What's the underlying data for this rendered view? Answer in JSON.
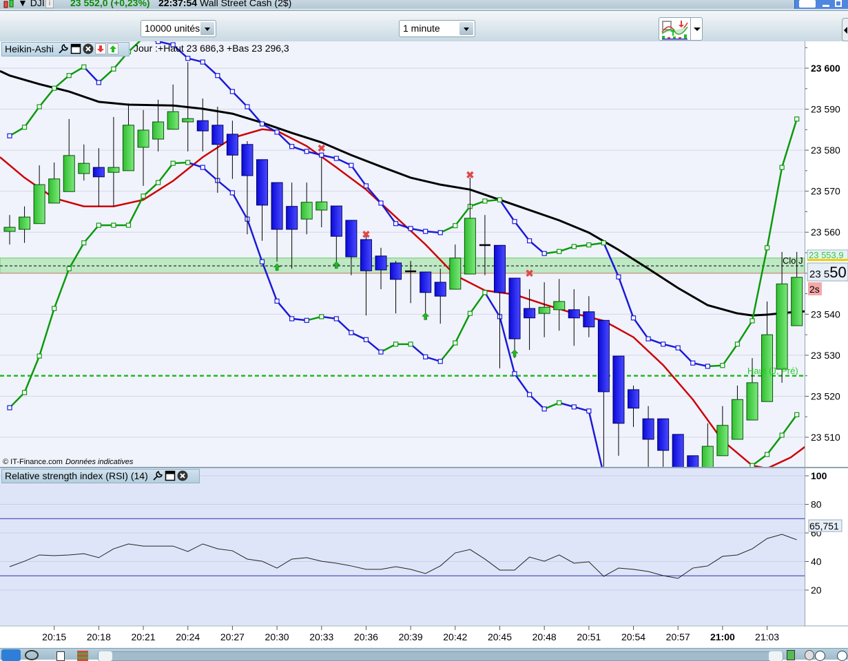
{
  "header": {
    "symbol": "DJI",
    "price_change": "23 552,0 (+0,23%)",
    "time": "22:37:54",
    "instrument": "Wall Street Cash (2$)"
  },
  "toolbar": {
    "quantity": "10000 unités",
    "timeframe": "1 minute"
  },
  "main_panel": {
    "indicator": "Heikin-Ashi",
    "day_info": "Jour :+Haut 23 686,3 +Bas 23 296,3",
    "copyright": "© IT-Finance.com",
    "disclaimer": "Données indicatives",
    "close_label": "Clo J",
    "prev_high_label": "Haut (J, Pré)",
    "close_price_tag": "23 553,9",
    "current_price_prefix": "23 5",
    "current_price_suffix": "50",
    "countdown": "2s"
  },
  "rsi_panel": {
    "title": "Relative strength index (RSI) (14)",
    "value_tag": "65,751"
  },
  "colors": {
    "up": "#46d046",
    "down": "#1c1cf0",
    "ma_long": "#000000",
    "ma_short": "#cc0000",
    "band_up": "#0a9a0a",
    "band_down": "#1a1ad8",
    "level": "#22bb22"
  },
  "chart_data": {
    "type": "candlestick",
    "start_time": "20:12",
    "interval": "1 minute",
    "x_ticks": [
      "20:15",
      "20:18",
      "20:21",
      "20:24",
      "20:27",
      "20:30",
      "20:33",
      "20:36",
      "20:39",
      "20:42",
      "20:45",
      "20:48",
      "20:51",
      "20:54",
      "20:57",
      "21:00",
      "21:03"
    ],
    "y_ticks": [
      23510,
      23520,
      23530,
      23540,
      23550,
      23560,
      23570,
      23580,
      23590,
      23600
    ],
    "y_tick_labels": [
      "23 510",
      "23 520",
      "23 530",
      "23 540",
      "23 550",
      "23 560",
      "23 570",
      "23 580",
      "23 590",
      "23 600"
    ],
    "ylim": [
      23497,
      23606.5
    ],
    "candles": [
      [
        23560.2,
        23564.2,
        23557.0,
        23561.2
      ],
      [
        23560.7,
        23566.3,
        23557.4,
        23563.7
      ],
      [
        23562.1,
        23576.3,
        23562.1,
        23571.6
      ],
      [
        23567.1,
        23577.0,
        23567.1,
        23573.0
      ],
      [
        23569.9,
        23587.6,
        23569.9,
        23578.7
      ],
      [
        23574.3,
        23581.4,
        23572.6,
        23576.8
      ],
      [
        23575.8,
        23580.5,
        23566.3,
        23573.5
      ],
      [
        23574.6,
        23588.1,
        23566.3,
        23575.8
      ],
      [
        23575.0,
        23591.4,
        23575.0,
        23586.1
      ],
      [
        23580.7,
        23589.8,
        23571.3,
        23584.9
      ],
      [
        23582.7,
        23592.3,
        23579.7,
        23586.9
      ],
      [
        23585.1,
        23596.0,
        23585.1,
        23589.4
      ],
      [
        23586.9,
        23601.5,
        23579.7,
        23587.7
      ],
      [
        23587.2,
        23592.6,
        23579.7,
        23584.7
      ],
      [
        23586.1,
        23590.6,
        23569.6,
        23581.4
      ],
      [
        23583.9,
        23587.2,
        23573.0,
        23578.8
      ],
      [
        23581.4,
        23582.2,
        23559.5,
        23573.8
      ],
      [
        23577.7,
        23577.7,
        23557.9,
        23566.6
      ],
      [
        23572.1,
        23572.1,
        23552.8,
        23560.7
      ],
      [
        23566.3,
        23572.1,
        23551.1,
        23560.7
      ],
      [
        23563.2,
        23572.1,
        23559.5,
        23567.3
      ],
      [
        23565.4,
        23578.3,
        23561.2,
        23567.4
      ],
      [
        23566.4,
        23566.4,
        23552.8,
        23559.0
      ],
      [
        23562.9,
        23562.9,
        23549.5,
        23554.0
      ],
      [
        23558.2,
        23559.5,
        23539.7,
        23550.6
      ],
      [
        23554.2,
        23556.2,
        23546.1,
        23550.8
      ],
      [
        23552.5,
        23553.0,
        23540.2,
        23548.5
      ],
      [
        23550.5,
        23553.0,
        23542.7,
        23550.3
      ],
      [
        23550.3,
        23550.3,
        23540.2,
        23545.3
      ],
      [
        23547.8,
        23551.1,
        23537.7,
        23544.4
      ],
      [
        23546.1,
        23557.0,
        23546.1,
        23553.7
      ],
      [
        23549.8,
        23573.3,
        23549.8,
        23563.4
      ],
      [
        23556.9,
        23564.2,
        23549.5,
        23556.8
      ],
      [
        23556.8,
        23556.8,
        23526.8,
        23545.3
      ],
      [
        23548.8,
        23548.8,
        23529.3,
        23534.0
      ],
      [
        23541.4,
        23546.1,
        23531.3,
        23539.1
      ],
      [
        23540.2,
        23547.8,
        23534.4,
        23541.7
      ],
      [
        23541.1,
        23548.6,
        23536.0,
        23543.1
      ],
      [
        23541.1,
        23546.1,
        23532.3,
        23539.1
      ],
      [
        23540.6,
        23544.4,
        23534.4,
        23536.9
      ],
      [
        23538.5,
        23538.5,
        23502.8,
        23521.1
      ],
      [
        23529.8,
        23529.8,
        23505.5,
        23513.4
      ],
      [
        23521.6,
        23522.6,
        23512.5,
        23517.1
      ],
      [
        23514.5,
        23517.6,
        23502.8,
        23509.5
      ],
      [
        23514.5,
        23514.5,
        23502.8,
        23506.8
      ],
      [
        23510.7,
        23510.7,
        23501.0,
        23502.5
      ],
      [
        23505.5,
        23505.5,
        23499.5,
        23501.0
      ],
      [
        23501.5,
        23513.4,
        23500.0,
        23507.8
      ],
      [
        23505.5,
        23517.6,
        23505.5,
        23512.9
      ],
      [
        23509.5,
        23522.6,
        23509.5,
        23519.2
      ],
      [
        23514.2,
        23529.3,
        23514.2,
        23523.3
      ],
      [
        23518.7,
        23543.1,
        23518.7,
        23535.0
      ],
      [
        23526.6,
        23555.2,
        23523.3,
        23547.4
      ],
      [
        23537.2,
        23555.2,
        23537.2,
        23549.0
      ]
    ],
    "candle_fields": [
      "open",
      "high",
      "low",
      "close"
    ],
    "ma_long": [
      [
        -0.65,
        23599.3
      ],
      [
        0,
        23598.2
      ],
      [
        2,
        23596.1
      ],
      [
        4,
        23594.3
      ],
      [
        6,
        23591.8
      ],
      [
        8,
        23591.1
      ],
      [
        11,
        23590.9
      ],
      [
        13,
        23590.1
      ],
      [
        15,
        23588.9
      ],
      [
        17,
        23586.7
      ],
      [
        19,
        23584.2
      ],
      [
        21,
        23581.9
      ],
      [
        23,
        23578.8
      ],
      [
        25,
        23576.0
      ],
      [
        27,
        23573.3
      ],
      [
        29,
        23571.6
      ],
      [
        31,
        23570.4
      ],
      [
        33,
        23567.9
      ],
      [
        35,
        23565.4
      ],
      [
        37,
        23562.9
      ],
      [
        39,
        23559.9
      ],
      [
        41,
        23555.7
      ],
      [
        43,
        23551.1
      ],
      [
        45,
        23546.4
      ],
      [
        47,
        23542.2
      ],
      [
        49,
        23540.2
      ],
      [
        50,
        23539.7
      ],
      [
        51,
        23539.9
      ],
      [
        53,
        23540.6
      ],
      [
        53.6,
        23540.7
      ]
    ],
    "ma_short": [
      [
        -0.65,
        23578.3
      ],
      [
        1,
        23573.3
      ],
      [
        3,
        23568.3
      ],
      [
        5,
        23566.3
      ],
      [
        7,
        23566.3
      ],
      [
        9,
        23567.9
      ],
      [
        11,
        23572.5
      ],
      [
        13,
        23578.3
      ],
      [
        15,
        23583.0
      ],
      [
        17,
        23585.1
      ],
      [
        18,
        23584.7
      ],
      [
        20,
        23581.0
      ],
      [
        22,
        23575.8
      ],
      [
        24,
        23570.4
      ],
      [
        26,
        23563.7
      ],
      [
        28,
        23557.0
      ],
      [
        30,
        23549.5
      ],
      [
        32,
        23545.8
      ],
      [
        34,
        23544.8
      ],
      [
        36,
        23542.4
      ],
      [
        38,
        23540.2
      ],
      [
        40,
        23538.4
      ],
      [
        42,
        23534.4
      ],
      [
        44,
        23527.6
      ],
      [
        46,
        23519.2
      ],
      [
        48,
        23509.2
      ],
      [
        50,
        23503.1
      ],
      [
        51,
        23502.4
      ],
      [
        52.6,
        23505.1
      ],
      [
        53.6,
        23507.8
      ]
    ],
    "band_upper": [
      23583.5,
      23585.6,
      23590.6,
      23595.1,
      23598.2,
      23600.3,
      23596.5,
      23599.8,
      23604.0,
      23607.4,
      23606.5,
      23605.7,
      23602.4,
      23601.5,
      23598.2,
      23594.3,
      23590.6,
      23586.4,
      23584.4,
      23580.9,
      23579.7,
      23578.8,
      23578.0,
      23576.3,
      23571.3,
      23567.1,
      23562.1,
      23560.9,
      23560.2,
      23559.9,
      23561.6,
      23566.3,
      23567.6,
      23567.9,
      23562.6,
      23557.9,
      23554.8,
      23555.3,
      23556.5,
      23556.9,
      23557.4,
      23549.1,
      23539.1,
      23534.0,
      23532.7,
      23531.8,
      23528.1,
      23527.3,
      23527.5,
      23532.7,
      23538.4,
      23556.2,
      23575.8,
      23587.6
    ],
    "band_lower": [
      23517.2,
      23520.9,
      23529.8,
      23541.4,
      23551.1,
      23557.4,
      23561.7,
      23561.7,
      23561.7,
      23568.8,
      23572.1,
      23576.8,
      23577.0,
      23575.8,
      23572.6,
      23569.6,
      23563.2,
      23552.8,
      23543.2,
      23538.9,
      23538.5,
      23539.4,
      23538.9,
      23535.5,
      23533.8,
      23530.8,
      23532.7,
      23532.7,
      23529.6,
      23528.5,
      23533.0,
      23540.2,
      23545.3,
      23539.4,
      23525.5,
      23520.4,
      23516.9,
      23518.4,
      23517.4,
      23516.4,
      23500.8,
      23495.7,
      23492.4,
      23489.9,
      23488.2,
      23487.7,
      23489.0,
      23491.5,
      23494.9,
      23499.1,
      23503.1,
      23505.8,
      23510.5,
      23515.5
    ],
    "buy_signals": [
      [
        18,
        23551.5
      ],
      [
        22,
        23552.0
      ],
      [
        28,
        23539.5
      ],
      [
        34,
        23530.5
      ]
    ],
    "sell_signals": [
      [
        31,
        23574.0
      ],
      [
        24,
        23559.5
      ],
      [
        35,
        23550.0
      ],
      [
        21,
        23580.5
      ]
    ],
    "levels": {
      "prev_high": 23525.0,
      "close_band": [
        23550.0,
        23553.7
      ],
      "close_line": 23551.8
    },
    "rsi": {
      "ylim": [
        0,
        100
      ],
      "y_ticks": [
        20,
        40,
        60,
        80,
        100
      ],
      "levels": [
        30,
        70
      ],
      "values": [
        36.4,
        40.2,
        44.6,
        44.1,
        44.6,
        45.5,
        42.7,
        48.9,
        52.3,
        50.8,
        50.8,
        50.8,
        47.0,
        52.3,
        48.9,
        47.5,
        41.7,
        40.2,
        35.4,
        41.7,
        42.7,
        40.2,
        38.8,
        36.9,
        34.5,
        34.5,
        36.4,
        34.5,
        31.6,
        36.9,
        46.0,
        48.4,
        41.7,
        34.0,
        34.0,
        43.1,
        40.2,
        44.6,
        38.8,
        39.8,
        29.6,
        35.4,
        34.5,
        33.0,
        30.1,
        28.2,
        35.4,
        36.9,
        43.6,
        44.6,
        48.9,
        56.1,
        59.0,
        55.2
      ]
    }
  }
}
